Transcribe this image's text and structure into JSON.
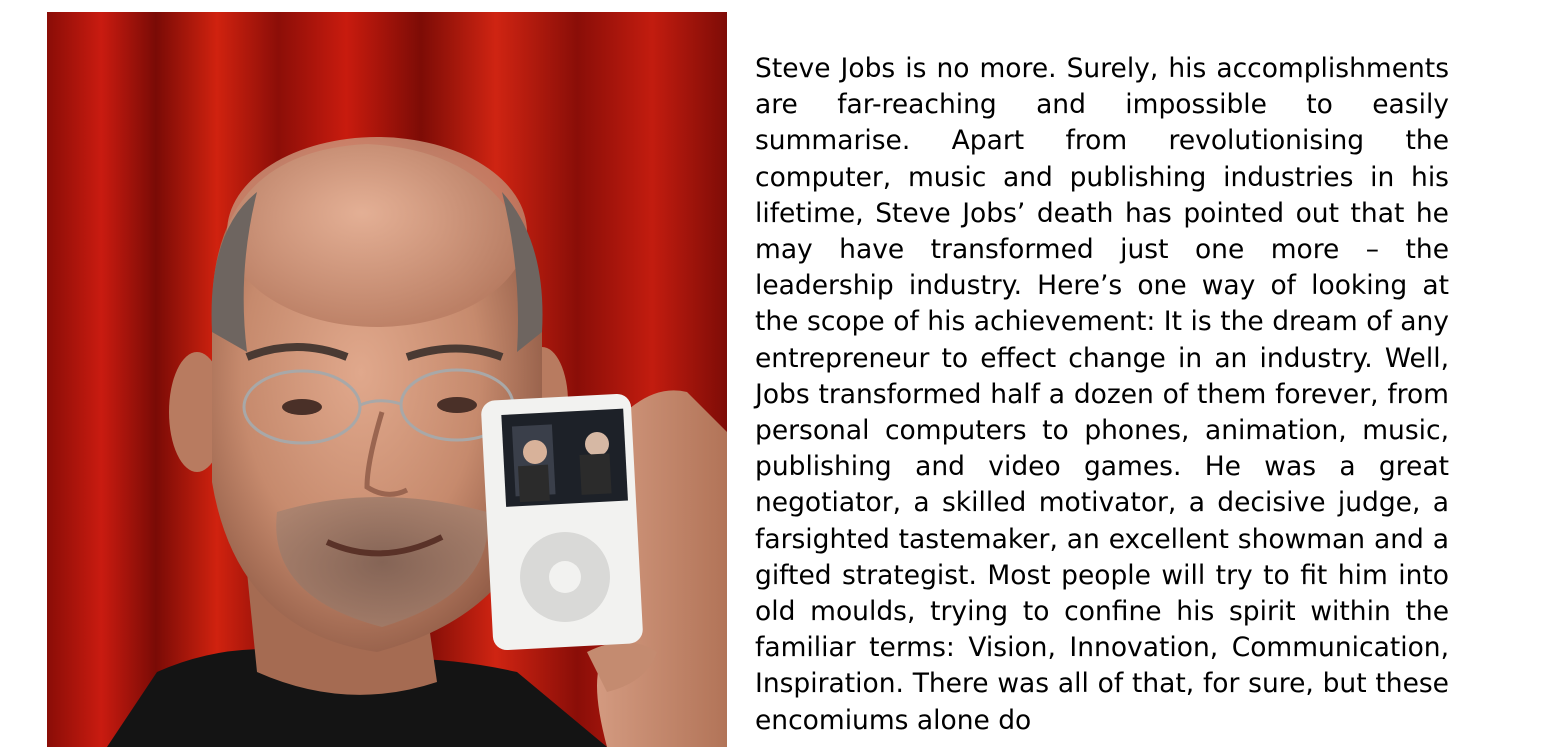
{
  "article": {
    "body": "Steve Jobs is no more. Surely, his accomplishments are far-reaching and impossible to easily summarise. Apart from revolutionising the computer, music and publishing industries in his lifetime, Steve Jobs’ death has pointed out that he may have transformed just one more – the leadership industry. Here’s one way of looking at the scope of his achievement: It is the dream of any entrepreneur to effect change in an industry. Well, Jobs transformed half a dozen of them forever, from personal computers to phones, animation, music, publishing and video games. He was a great negotiator, a skilled motivator, a decisive judge, a farsighted tastemaker, an excellent showman and a gifted strategist. Most people will try to fit him into old moulds, trying to confine his spirit within the familiar terms: Vision, Innovation, Communication, Inspiration. There was all of that, for sure, but these encomiums alone do"
  },
  "photo": {
    "subject": "man-holding-white-media-player",
    "colors": {
      "curtain": "#b0140d",
      "skin": "#c98d72",
      "shirt": "#141414",
      "device": "#f2f2f0"
    }
  }
}
